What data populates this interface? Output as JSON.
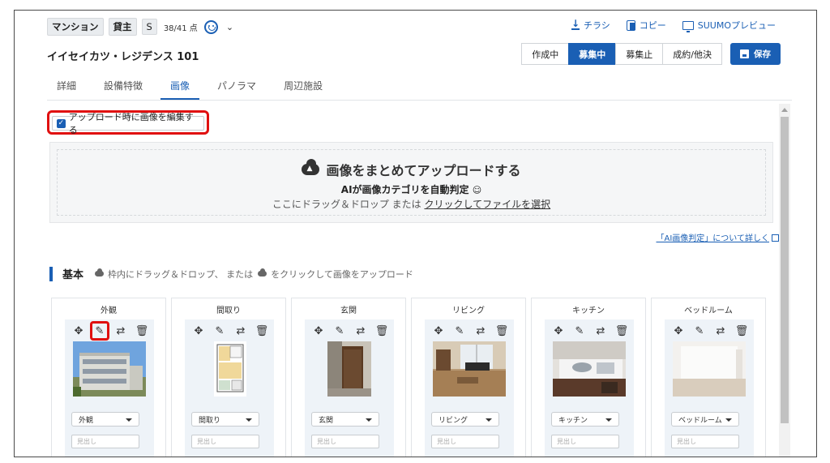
{
  "header": {
    "tags": [
      "マンション",
      "貸主",
      "S"
    ],
    "score": "38/41 点",
    "links": {
      "flyer": "チラシ",
      "copy": "コピー",
      "preview": "SUUMOプレビュー"
    },
    "title": "イイセイカツ・レジデンス 101",
    "status": [
      "作成中",
      "募集中",
      "募集止",
      "成約/他決"
    ],
    "status_active": "募集中",
    "save_label": "保存",
    "accent": "#1a5fb4"
  },
  "tabs": [
    {
      "label": "詳細"
    },
    {
      "label": "設備特徴"
    },
    {
      "label": "画像",
      "active": true
    },
    {
      "label": "パノラマ"
    },
    {
      "label": "周辺施設"
    }
  ],
  "upload": {
    "edit_checkbox_label": "アップロード時に画像を編集する",
    "dropzone_title": "画像をまとめてアップロードする",
    "dropzone_ai": "AIが画像カテゴリを自動判定",
    "dropzone_hint_prefix": "ここにドラッグ＆ドロップ または ",
    "dropzone_link": "クリックしてファイルを選択",
    "ai_info_link": "「AI画像判定」について詳しく"
  },
  "section": {
    "title": "基本",
    "hint_a": "枠内にドラッグ＆ドロップ、 または",
    "hint_b": "をクリックして画像をアップロード"
  },
  "cards": [
    {
      "label": "外観",
      "select": "外観",
      "placeholder": "見出し"
    },
    {
      "label": "間取り",
      "select": "間取り",
      "placeholder": "見出し"
    },
    {
      "label": "玄関",
      "select": "玄関",
      "placeholder": "見出し"
    },
    {
      "label": "リビング",
      "select": "リビング",
      "placeholder": "見出し"
    },
    {
      "label": "キッチン",
      "select": "キッチン",
      "placeholder": "見出し"
    },
    {
      "label": "ベッドルーム",
      "select": "ベッドルーム",
      "placeholder": "見出し"
    }
  ]
}
